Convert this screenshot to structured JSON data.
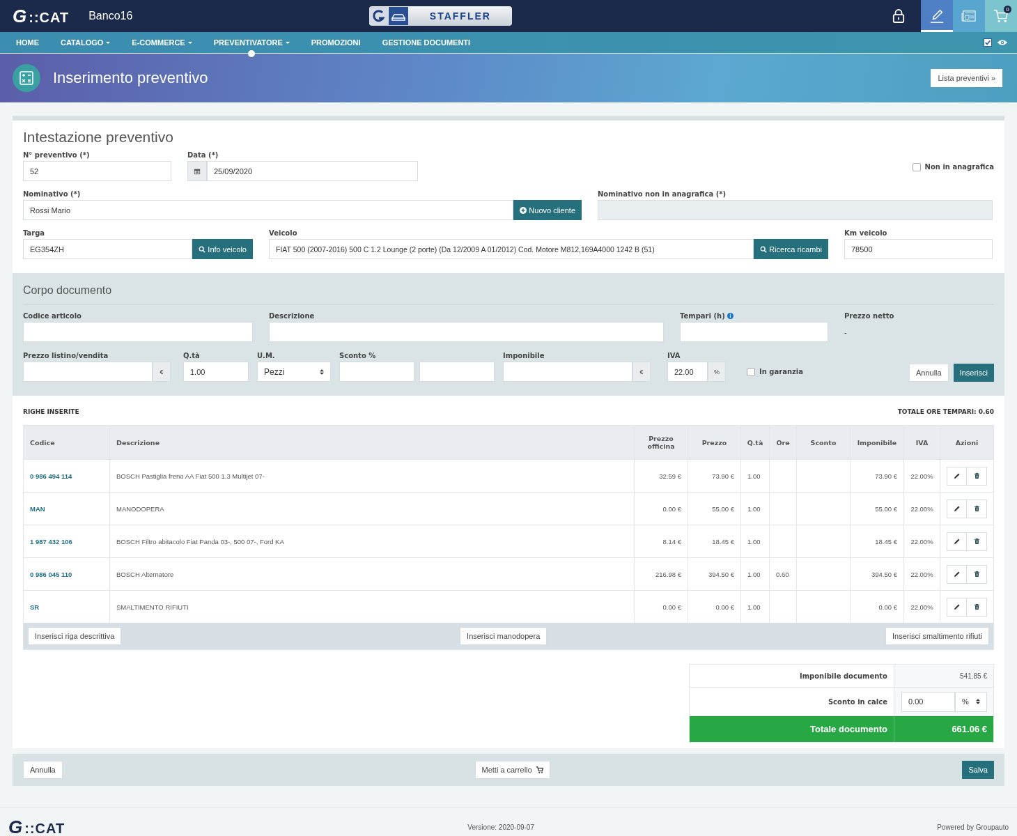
{
  "topbar": {
    "logo_mark": "G",
    "logo_text": "::CAT",
    "workstation": "Banco16",
    "brand_badge": "STAFFLER",
    "actions": [
      {
        "kind": "lock",
        "selected": false
      },
      {
        "kind": "pencil",
        "selected": true
      },
      {
        "kind": "news",
        "selected": false
      },
      {
        "kind": "cart",
        "selected": false,
        "badge": "0"
      }
    ]
  },
  "nav": {
    "items": [
      {
        "label": "HOME",
        "has_menu": false,
        "selected": false
      },
      {
        "label": "CATALOGO",
        "has_menu": true,
        "selected": false
      },
      {
        "label": "E-COMMERCE",
        "has_menu": true,
        "selected": false
      },
      {
        "label": "PREVENTIVATORE",
        "has_menu": true,
        "selected": true
      },
      {
        "label": "PROMOZIONI",
        "has_menu": false,
        "selected": false
      },
      {
        "label": "GESTIONE DOCUMENTI",
        "has_menu": false,
        "selected": false
      }
    ],
    "option_checked": true
  },
  "page_header": {
    "title": "Inserimento preventivo",
    "list_button": "Lista preventivi »"
  },
  "intestazione": {
    "title": "Intestazione preventivo",
    "numero": {
      "label": "N° preventivo (*)",
      "value": "52"
    },
    "data": {
      "label": "Data (*)",
      "value": "25/09/2020"
    },
    "non_in_anagrafica": {
      "label": "Non in anagrafica",
      "checked": false
    },
    "nominativo": {
      "label": "Nominativo (*)",
      "value": "Rossi Mario",
      "button": "Nuovo cliente"
    },
    "nominativo_extra": {
      "label": "Nominativo non in anagrafica (*)",
      "disabled": true
    },
    "targa": {
      "label": "Targa",
      "value": "EG354ZH",
      "button": "Info veicolo"
    },
    "veicolo": {
      "label": "Veicolo",
      "value": "FIAT 500 (2007-2016) 500 C 1.2 Lounge (2 porte) (Da 12/2009 A 01/2012) Cod. Motore M812,169A4000 1242 B (51)",
      "button": "Ricerca ricambi"
    },
    "km": {
      "label": "Km veicolo",
      "value": "78500"
    }
  },
  "corpo": {
    "title": "Corpo documento",
    "codice": {
      "label": "Codice articolo"
    },
    "descrizione": {
      "label": "Descrizione"
    },
    "tempari": {
      "label": "Tempari (h)"
    },
    "prezzo_netto": {
      "label": "Prezzo netto",
      "value": "-"
    },
    "prezzo_listino": {
      "label": "Prezzo listino/vendita",
      "addon": "€"
    },
    "qta": {
      "label": "Q.tà",
      "value": "1.00"
    },
    "um": {
      "label": "U.M.",
      "value": "Pezzi"
    },
    "sconto": {
      "label": "Sconto %"
    },
    "imponibile": {
      "label": "Imponibile",
      "addon": "€"
    },
    "iva": {
      "label": "IVA",
      "value": "22.00",
      "addon": "%"
    },
    "garanzia": {
      "label": "In garanzia",
      "checked": false
    },
    "cancel": "Annulla",
    "insert": "Inserisci"
  },
  "righe": {
    "title": "RIGHE INSERITE",
    "total_hours": "TOTALE ORE TEMPARI: 0.60",
    "columns": [
      "Codice",
      "Descrizione",
      "Prezzo officina",
      "Prezzo",
      "Q.tà",
      "Ore",
      "Sconto",
      "Imponibile",
      "IVA",
      "Azioni"
    ],
    "rows": [
      {
        "codice": "0 986 494 114",
        "descrizione": "BOSCH Pastiglia freno AA Fiat 500 1.3 Multijet 07-",
        "prezzo_officina": "32.59 €",
        "prezzo": "73.90 €",
        "qta": "1.00",
        "ore": "",
        "sconto": "",
        "imponibile": "73.90 €",
        "iva": "22.00%"
      },
      {
        "codice": "MAN",
        "descrizione": "MANODOPERA",
        "prezzo_officina": "0.00 €",
        "prezzo": "55.00 €",
        "qta": "1.00",
        "ore": "",
        "sconto": "",
        "imponibile": "55.00 €",
        "iva": "22.00%"
      },
      {
        "codice": "1 987 432 106",
        "descrizione": "BOSCH Filtro abitacolo Fiat Panda 03-, 500 07-, Ford KA",
        "prezzo_officina": "8.14 €",
        "prezzo": "18.45 €",
        "qta": "1.00",
        "ore": "",
        "sconto": "",
        "imponibile": "18.45 €",
        "iva": "22.00%"
      },
      {
        "codice": "0 986 045 110",
        "descrizione": "BOSCH Alternatore",
        "prezzo_officina": "216.98 €",
        "prezzo": "394.50 €",
        "qta": "1.00",
        "ore": "0.60",
        "sconto": "",
        "imponibile": "394.50 €",
        "iva": "22.00%"
      },
      {
        "codice": "SR",
        "descrizione": "SMALTIMENTO RIFIUTI",
        "prezzo_officina": "0.00 €",
        "prezzo": "0.00 €",
        "qta": "1.00",
        "ore": "",
        "sconto": "",
        "imponibile": "0.00 €",
        "iva": "22.00%"
      }
    ],
    "buttons": [
      "Inserisci riga descrittiva",
      "Inserisci manodopera",
      "Inserisci smaltimento rifiuti"
    ]
  },
  "totali": {
    "imponibile_label": "Imponibile documento",
    "imponibile_value": "541.85 €",
    "sconto_label": "Sconto in calce",
    "sconto_value": "0.00",
    "sconto_unit": "%",
    "totale_label": "Totale documento",
    "totale_value": "661.06 €"
  },
  "actions": {
    "cancel": "Annulla",
    "cart": "Metti a carrello",
    "save": "Salva"
  },
  "footer": {
    "logo_mark": "G",
    "logo_text": "::CAT",
    "version": "Versione: 2020-09-07",
    "powered": "Powered by Groupauto"
  }
}
